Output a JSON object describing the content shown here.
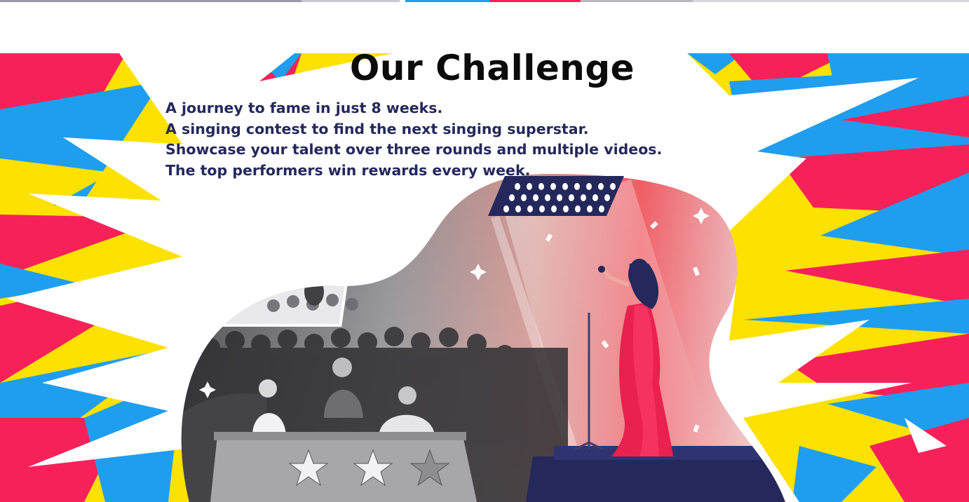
{
  "colors": {
    "pink": "#f7215a",
    "blue": "#1f9ef0",
    "yellow": "#fde100",
    "navy": "#24285b",
    "coral": "#ee3b52"
  },
  "section": {
    "title": "Our Challenge",
    "lines": [
      "A journey to fame in just 8 weeks.",
      "A singing contest to find the next singing superstar.",
      "Showcase your talent over three rounds and multiple videos.",
      "The top performers win rewards every week."
    ]
  },
  "illustration": {
    "subject": "singer-on-stage-with-judges-and-audience",
    "judge_table_stars": 3
  }
}
